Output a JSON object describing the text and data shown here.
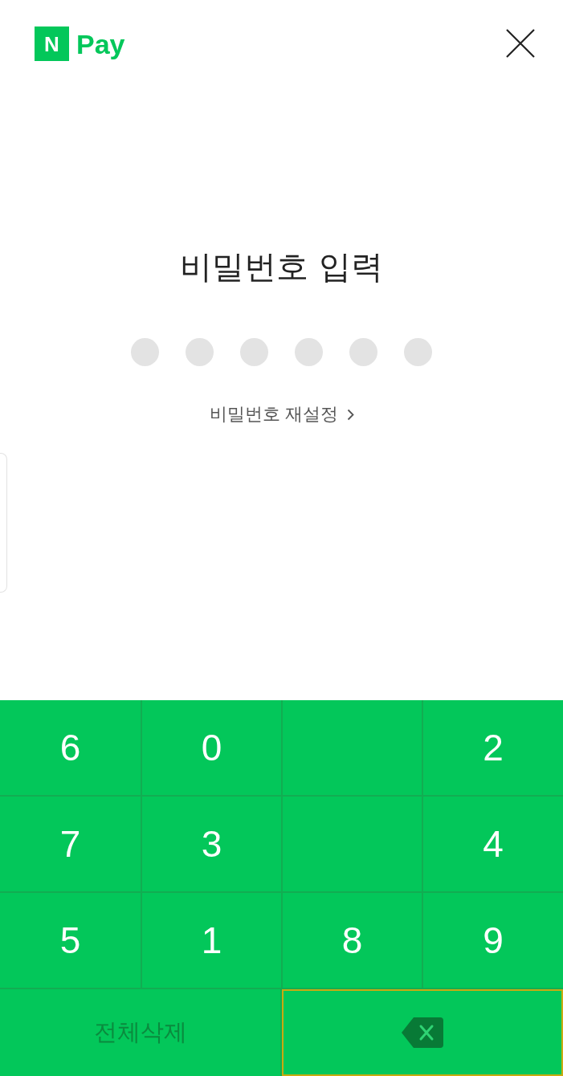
{
  "header": {
    "logo": {
      "mark": "N",
      "text": "Pay"
    }
  },
  "title": "비밀번호 입력",
  "pin": {
    "dots": [
      {
        "filled": false
      },
      {
        "filled": false
      },
      {
        "filled": false
      },
      {
        "filled": false
      },
      {
        "filled": false
      },
      {
        "filled": false
      }
    ]
  },
  "reset_link": {
    "label": "비밀번호 재설정"
  },
  "keypad": {
    "rows": [
      [
        {
          "kind": "digit",
          "label": "6"
        },
        {
          "kind": "digit",
          "label": "0"
        },
        {
          "kind": "blank"
        },
        {
          "kind": "digit",
          "label": "2"
        }
      ],
      [
        {
          "kind": "digit",
          "label": "7"
        },
        {
          "kind": "digit",
          "label": "3"
        },
        {
          "kind": "blank"
        },
        {
          "kind": "digit",
          "label": "4"
        }
      ],
      [
        {
          "kind": "digit",
          "label": "5"
        },
        {
          "kind": "digit",
          "label": "1"
        },
        {
          "kind": "digit",
          "label": "8"
        },
        {
          "kind": "digit",
          "label": "9"
        }
      ]
    ],
    "actions": [
      {
        "kind": "clear",
        "label": "전체삭제",
        "focused": false
      },
      {
        "kind": "backspace",
        "focused": true
      }
    ]
  }
}
